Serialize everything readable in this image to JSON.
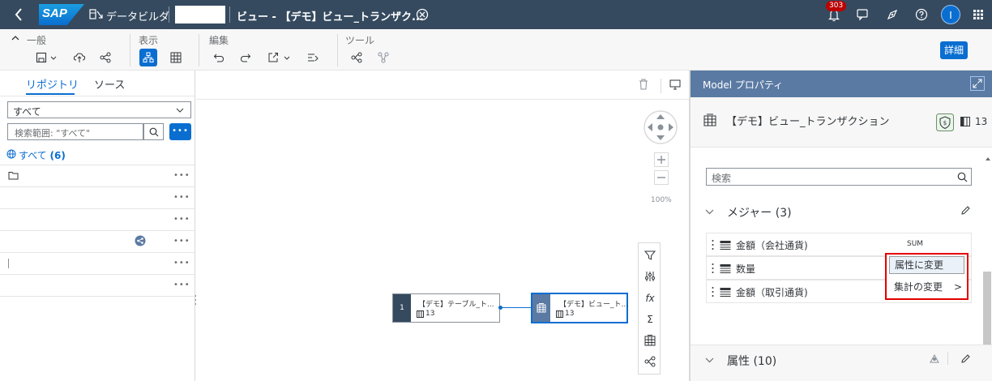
{
  "shell": {
    "logo_text": "SAP",
    "app_name": "データビルダ",
    "document_title": "ビュー - 【デモ】ビュー_トランザク...",
    "notification_count": "303",
    "avatar_initial": "I"
  },
  "toolbar": {
    "groups": {
      "general": "一般",
      "view": "表示",
      "edit": "編集",
      "tools": "ツール"
    },
    "detail_button": "詳細"
  },
  "left_panel": {
    "tabs": [
      "リポジトリ",
      "ソース"
    ],
    "filter_value": "すべて",
    "search_placeholder": "検索範囲: \"すべて\"",
    "all_label": "すべて",
    "all_count": "(6)",
    "more_label": "•••"
  },
  "canvas": {
    "zoom_level": "100%",
    "source_node": {
      "index": "1",
      "title": "【デモ】テーブル_ト...",
      "column_count": "13"
    },
    "target_node": {
      "title": "【デモ】ビュー_ト...",
      "column_count": "13"
    },
    "tools": {
      "function_label": "fx",
      "sum_label": "Σ"
    }
  },
  "properties": {
    "header": "Model プロパティ",
    "object_title": "【デモ】ビュー_トランザクション",
    "column_count": "13",
    "search_placeholder": "検索",
    "measures_title": "メジャー (3)",
    "measures": [
      {
        "name": "金額（会社通貨)",
        "aggregation": "SUM"
      },
      {
        "name": "数量",
        "aggregation": ""
      },
      {
        "name": "金額（取引通貨)",
        "aggregation": ""
      }
    ],
    "attributes_title": "属性 (10)"
  },
  "context_menu": {
    "items": [
      "属性に変更",
      "集計の変更"
    ],
    "submenu_arrow": ">"
  },
  "colors": {
    "shell_bg": "#354a5f",
    "accent": "#0a6ed1",
    "panel_header": "#5b7aa3",
    "highlight_border": "#e30000"
  }
}
